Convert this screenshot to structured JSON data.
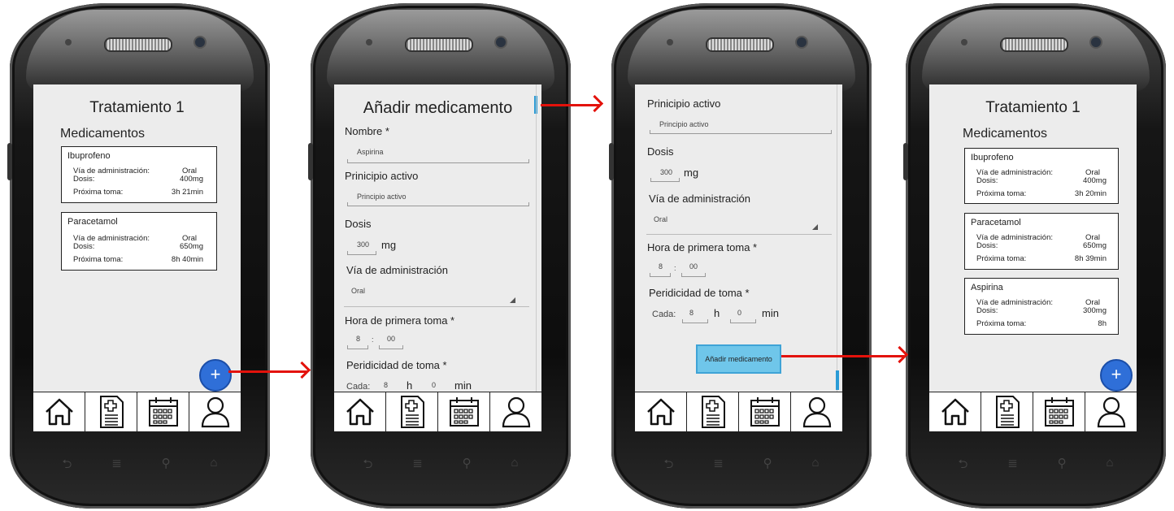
{
  "screens": {
    "list1": {
      "title": "Tratamiento 1",
      "section": "Medicamentos",
      "cards": [
        {
          "name": "Ibuprofeno",
          "via_label": "Vía de administración:",
          "via": "Oral",
          "dose_label": "Dosis:",
          "dose": "400mg",
          "next_label": "Próxima toma:",
          "next": "3h 21min"
        },
        {
          "name": "Paracetamol",
          "via_label": "Vía de administración:",
          "via": "Oral",
          "dose_label": "Dosis:",
          "dose": "650mg",
          "next_label": "Próxima toma:",
          "next": "8h 40min"
        }
      ],
      "fab": "+"
    },
    "form1": {
      "title": "Añadir medicamento",
      "nombre_label": "Nombre *",
      "nombre_value": "Aspirina",
      "principio_label": "Prinicipio activo",
      "principio_value": "Principio activo",
      "dosis_label": "Dosis",
      "dosis_value": "300",
      "dosis_unit": "mg",
      "via_label": "Vía de administración",
      "via_value": "Oral",
      "hora_label": "Hora de primera toma *",
      "hora_h": "8",
      "hora_sep": ":",
      "hora_m": "00",
      "per_label": "Peridicidad de toma *",
      "cada_label": "Cada:",
      "cada_h": "8",
      "h_unit": "h",
      "cada_m": "0",
      "min_unit": "min"
    },
    "form2": {
      "principio_label": "Prinicipio activo",
      "principio_value": "Principio activo",
      "dosis_label": "Dosis",
      "dosis_value": "300",
      "dosis_unit": "mg",
      "via_label": "Vía de administración",
      "via_value": "Oral",
      "hora_label": "Hora de primera toma *",
      "hora_h": "8",
      "hora_sep": ":",
      "hora_m": "00",
      "per_label": "Peridicidad de toma *",
      "cada_label": "Cada:",
      "cada_h": "8",
      "h_unit": "h",
      "cada_m": "0",
      "min_unit": "min",
      "button": "Añadir medicamento"
    },
    "list2": {
      "title": "Tratamiento 1",
      "section": "Medicamentos",
      "cards": [
        {
          "name": "Ibuprofeno",
          "via_label": "Vía de administración:",
          "via": "Oral",
          "dose_label": "Dosis:",
          "dose": "400mg",
          "next_label": "Próxima toma:",
          "next": "3h 20min"
        },
        {
          "name": "Paracetamol",
          "via_label": "Vía de administración:",
          "via": "Oral",
          "dose_label": "Dosis:",
          "dose": "650mg",
          "next_label": "Próxima toma:",
          "next": "8h 39min"
        },
        {
          "name": "Aspirina",
          "via_label": "Vía de administración:",
          "via": "Oral",
          "dose_label": "Dosis:",
          "dose": "300mg",
          "next_label": "Próxima toma:",
          "next": "8h"
        }
      ],
      "fab": "+"
    }
  },
  "nav_icons": [
    "home-icon",
    "prescription-icon",
    "calendar-icon",
    "user-icon"
  ],
  "colors": {
    "arrow": "#e3120b",
    "fab": "#2f6fd8",
    "button": "#6fc6ea",
    "scrollbar": "#2a9bd6"
  }
}
